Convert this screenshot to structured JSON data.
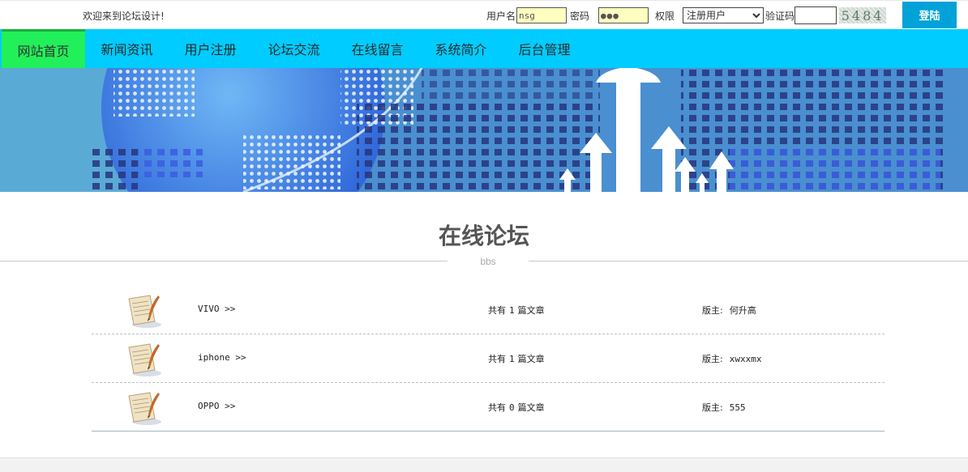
{
  "header": {
    "welcome": "欢迎来到论坛设计!",
    "login": {
      "username_label": "用户名",
      "username_value": "nsg",
      "password_label": "密码",
      "password_value": "●●●",
      "role_label": "权限",
      "role_selected": "注册用户",
      "code_label": "验证码",
      "code_value": "",
      "captcha_text": "5484",
      "login_button": "登陆"
    }
  },
  "nav": {
    "items": [
      {
        "label": "网站首页",
        "active": true
      },
      {
        "label": "新闻资讯"
      },
      {
        "label": "用户注册"
      },
      {
        "label": "论坛交流"
      },
      {
        "label": "在线留言"
      },
      {
        "label": "系统简介"
      },
      {
        "label": "后台管理"
      }
    ]
  },
  "section": {
    "title": "在线论坛",
    "subtitle": "bbs"
  },
  "forums": [
    {
      "name": "VIVO >>",
      "count_prefix": "共有",
      "count": "1",
      "count_suffix": "篇文章",
      "moderator_label": "版主:",
      "moderator": "何升高"
    },
    {
      "name": "iphone >>",
      "count_prefix": "共有",
      "count": "1",
      "count_suffix": "篇文章",
      "moderator_label": "版主:",
      "moderator": "xwxxmx"
    },
    {
      "name": "OPPO >>",
      "count_prefix": "共有",
      "count": "0",
      "count_suffix": "篇文章",
      "moderator_label": "版主:",
      "moderator": "555"
    }
  ],
  "colors": {
    "nav_bg": "#00ccff",
    "nav_active": "#22f05a",
    "login_button": "#00a2d8",
    "input_bg": "#ffffc0"
  },
  "icons": {
    "forum_icon": "quill-paper-icon",
    "banner": "globe-arrows-banner"
  }
}
